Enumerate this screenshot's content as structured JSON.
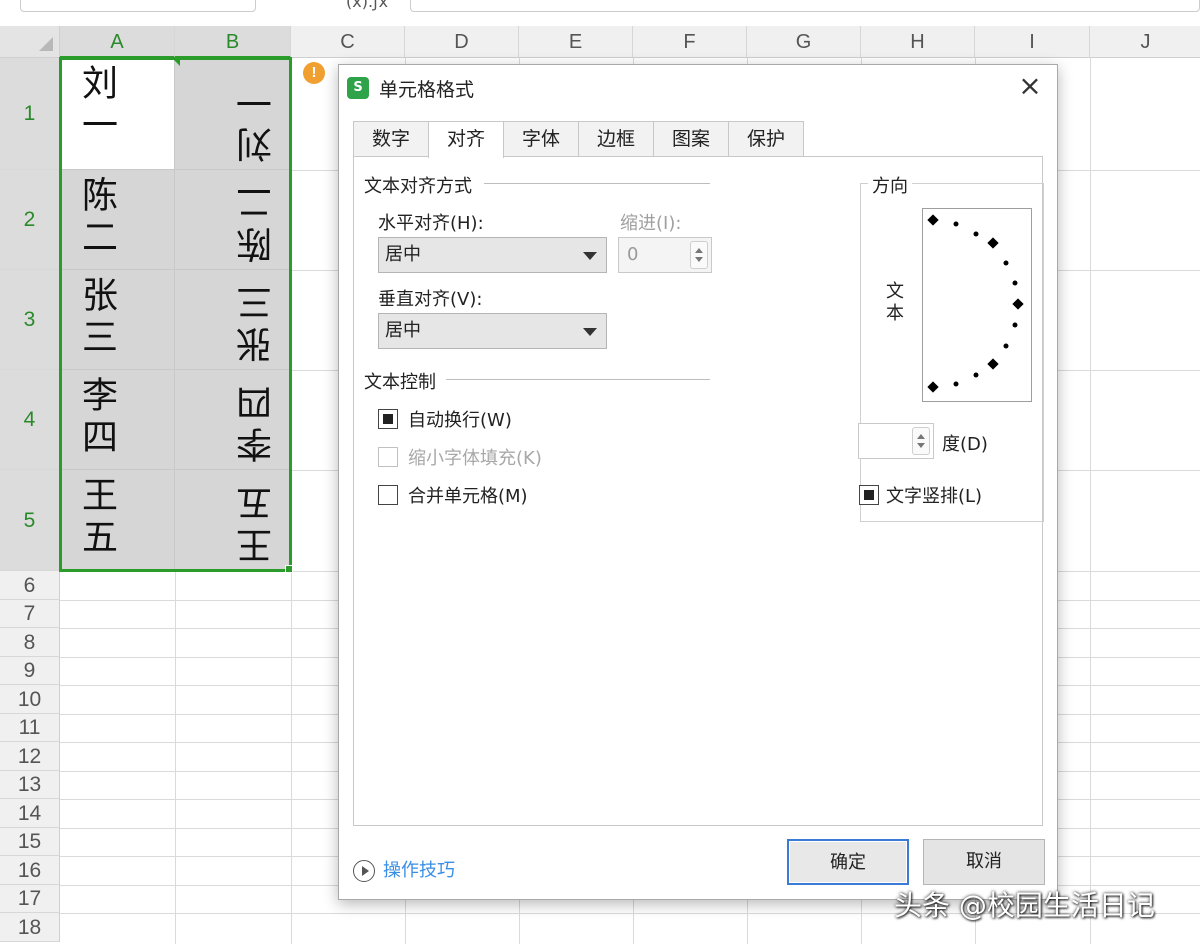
{
  "formula_bar": {
    "name_box": "",
    "fx_label": "(ⅹ).ƒⅹ"
  },
  "columns": [
    "A",
    "B",
    "C",
    "D",
    "E",
    "F",
    "G",
    "H",
    "I",
    "J"
  ],
  "rows": [
    "1",
    "2",
    "3",
    "4",
    "5",
    "6",
    "7",
    "8",
    "9",
    "10",
    "11",
    "12",
    "13",
    "14",
    "15",
    "16",
    "17",
    "18"
  ],
  "cells_a": [
    "刘一",
    "陈二",
    "张三",
    "李四",
    "王五"
  ],
  "cells_b": [
    "刘一",
    "陈二",
    "张三",
    "李四",
    "王五"
  ],
  "warning_icon": "!",
  "dialog": {
    "title": "单元格格式",
    "logo": "S",
    "close": "×",
    "tabs": [
      "数字",
      "对齐",
      "字体",
      "边框",
      "图案",
      "保护"
    ],
    "active_tab": "对齐",
    "alignment_group": "文本对齐方式",
    "horizontal_label": "水平对齐(H):",
    "horizontal_value": "居中",
    "indent_label": "缩进(I):",
    "indent_value": "0",
    "vertical_label": "垂直对齐(V):",
    "vertical_value": "居中",
    "control_group": "文本控制",
    "wrap_text": {
      "label": "自动换行(W)",
      "checked": true
    },
    "shrink_to_fit": {
      "label": "缩小字体填充(K)",
      "checked": false,
      "disabled": true
    },
    "merge_cells": {
      "label": "合并单元格(M)",
      "checked": false
    },
    "orientation_group": "方向",
    "orientation_vertical_text": "文本",
    "degrees_value": "",
    "degrees_label": "度(D)",
    "vertical_text": {
      "label": "文字竖排(L)",
      "checked": true
    },
    "help_link": "操作技巧",
    "ok": "确定",
    "cancel": "取消"
  },
  "watermark": "头条 @校园生活日记",
  "colors": {
    "selection": "#2a9c2a",
    "cell_fill": "#d6d6d6",
    "link": "#3a8ee6",
    "ok_border": "#3a7bd5"
  }
}
